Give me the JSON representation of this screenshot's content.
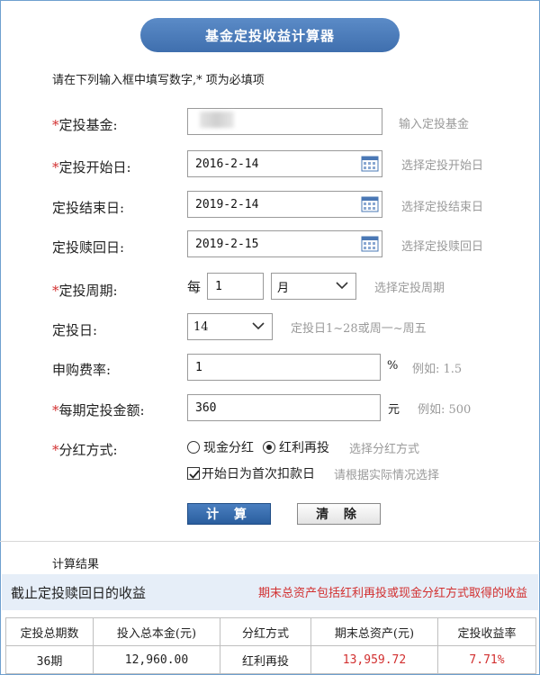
{
  "title": "基金定投收益计算器",
  "hint": "请在下列输入框中填写数字,* 项为必填项",
  "required_mark": "*",
  "fields": {
    "fund": {
      "label": "定投基金:",
      "desc": "输入定投基金"
    },
    "start": {
      "label": "定投开始日:",
      "value": "2016-2-14",
      "desc": "选择定投开始日"
    },
    "end": {
      "label": "定投结束日:",
      "value": "2019-2-14",
      "desc": "选择定投结束日"
    },
    "redeem": {
      "label": "定投赎回日:",
      "value": "2019-2-15",
      "desc": "选择定投赎回日"
    },
    "period": {
      "label": "定投周期:",
      "prefix": "每",
      "count": "1",
      "unit": "月",
      "desc": "选择定投周期"
    },
    "day": {
      "label": "定投日:",
      "value": "14",
      "desc": "定投日1~28或周一~周五"
    },
    "fee": {
      "label": "申购费率:",
      "value": "1",
      "unit": "%",
      "desc": "例如: 1.5"
    },
    "amount": {
      "label": "每期定投金额:",
      "value": "360",
      "unit": "元",
      "desc": "例如: 500"
    },
    "dividend": {
      "label": "分红方式:",
      "option1": "现金分红",
      "option2": "红利再投",
      "selected": "红利再投",
      "desc": "选择分红方式"
    },
    "first_debit": {
      "label": "开始日为首次扣款日",
      "checked": true,
      "desc": "请根据实际情况选择"
    }
  },
  "buttons": {
    "calc": "计 算",
    "clear": "清 除"
  },
  "result": {
    "section_title": "计算结果",
    "band_left": "截止定投赎回日的收益",
    "band_right": "期末总资产包括红利再投或现金分红方式取得的收益",
    "headers": [
      "定投总期数",
      "投入总本金(元)",
      "分红方式",
      "期末总资产(元)",
      "定投收益率"
    ],
    "row": [
      "36期",
      "12,960.00",
      "红利再投",
      "13,959.72",
      "7.71%"
    ]
  },
  "colors": {
    "accent": "#3f6fae",
    "required": "#d23030",
    "band": "#e6eef8"
  }
}
